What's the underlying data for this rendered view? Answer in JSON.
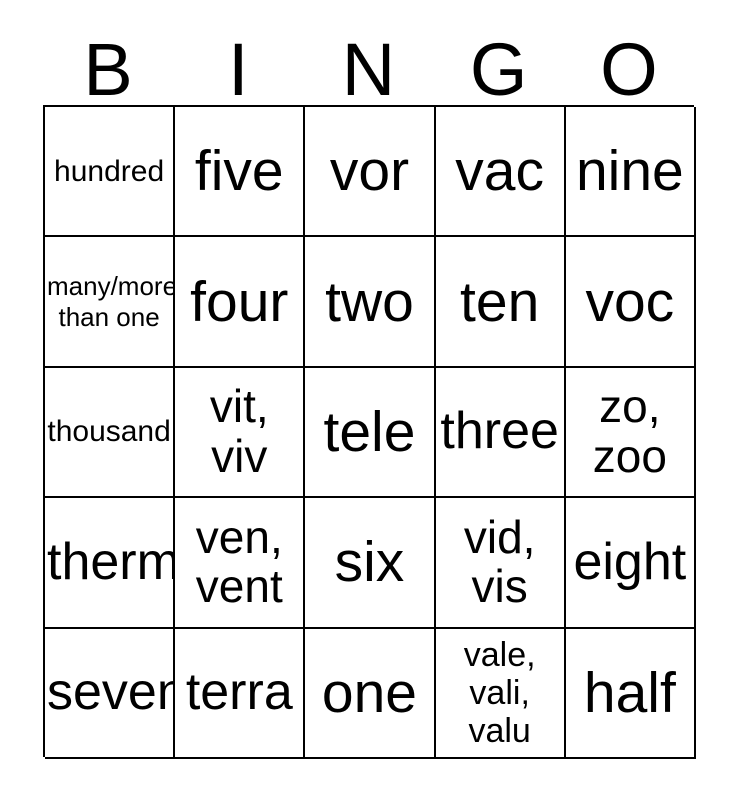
{
  "card": {
    "title": "BINGO",
    "header_letters": [
      "B",
      "I",
      "N",
      "G",
      "O"
    ],
    "rows": [
      [
        {
          "text": "hundred",
          "size": "t-xs"
        },
        {
          "text": "five",
          "size": "t-xl"
        },
        {
          "text": "vor",
          "size": "t-xl"
        },
        {
          "text": "vac",
          "size": "t-xl"
        },
        {
          "text": "nine",
          "size": "t-xl"
        }
      ],
      [
        {
          "text": "many/more\nthan one",
          "size": "t-xxs"
        },
        {
          "text": "four",
          "size": "t-xl"
        },
        {
          "text": "two",
          "size": "t-xl"
        },
        {
          "text": "ten",
          "size": "t-xl"
        },
        {
          "text": "voc",
          "size": "t-xl"
        }
      ],
      [
        {
          "text": "thousand",
          "size": "t-xs"
        },
        {
          "text": "vit,\nviv",
          "size": "t-md"
        },
        {
          "text": "tele",
          "size": "t-xl"
        },
        {
          "text": "three",
          "size": "t-lg"
        },
        {
          "text": "zo,\nzoo",
          "size": "t-md"
        }
      ],
      [
        {
          "text": "therm",
          "size": "t-lg"
        },
        {
          "text": "ven,\nvent",
          "size": "t-md"
        },
        {
          "text": "six",
          "size": "t-xl"
        },
        {
          "text": "vid,\nvis",
          "size": "t-md"
        },
        {
          "text": "eight",
          "size": "t-lg"
        }
      ],
      [
        {
          "text": "seven",
          "size": "t-lg"
        },
        {
          "text": "terra",
          "size": "t-lg"
        },
        {
          "text": "one",
          "size": "t-xl"
        },
        {
          "text": "vale,\nvali,\nvalu",
          "size": "t-sm"
        },
        {
          "text": "half",
          "size": "t-xl"
        }
      ]
    ]
  },
  "colors": {
    "background": "#ffffff",
    "text": "#000000",
    "grid_line": "#000000"
  }
}
